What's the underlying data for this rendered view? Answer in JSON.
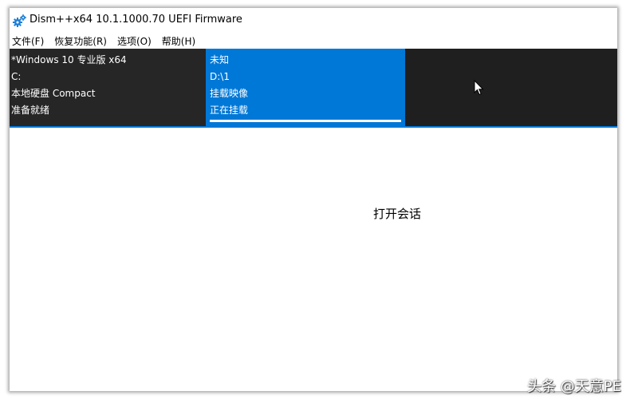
{
  "window": {
    "title": "Dism++x64 10.1.1000.70 UEFI Firmware",
    "app_icon": "gears-icon"
  },
  "menu": {
    "items": [
      {
        "label": "文件(F)"
      },
      {
        "label": "恢复功能(R)"
      },
      {
        "label": "选项(O)"
      },
      {
        "label": "帮助(H)"
      }
    ]
  },
  "sessions": [
    {
      "name": "*Windows 10 专业版 x64",
      "drive": "C:",
      "type": "本地硬盘 Compact",
      "status": "准备就绪"
    },
    {
      "name": "未知",
      "drive": "D:\\1",
      "type": "挂载映像",
      "status": "正在挂载",
      "progress": 1.0
    }
  ],
  "main": {
    "open_session_label": "打开会话"
  },
  "watermark": "头条 @天意PE",
  "colors": {
    "accent": "#0078d7",
    "session_bar": "#1f1f1f",
    "card_selected": "#0078d7"
  }
}
